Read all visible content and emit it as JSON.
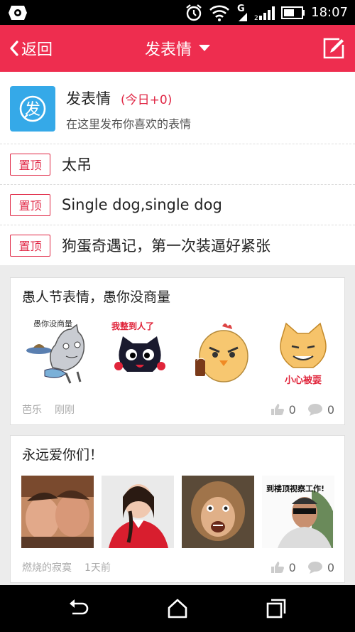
{
  "status_bar": {
    "time": "18:07",
    "icons": [
      "settings-icon",
      "alarm-icon",
      "wifi-icon",
      "signal-g-icon",
      "signal-bars-icon",
      "battery-icon"
    ]
  },
  "header": {
    "back_label": "返回",
    "title": "发表情",
    "icons": [
      "back-chevron-icon",
      "dropdown-arrow-icon",
      "edit-icon"
    ],
    "color": "#ee2d4f"
  },
  "category": {
    "icon_char": "发",
    "title": "发表情",
    "today_count": "(今日+0)",
    "description": "在这里发布你喜欢的表情",
    "icon_color": "#35a9e8"
  },
  "pinned": [
    {
      "badge": "置顶",
      "text": "太吊"
    },
    {
      "badge": "置顶",
      "text": "Single dog,single dog"
    },
    {
      "badge": "置顶",
      "text": "狗蛋奇遇记，第一次装逼好紧张"
    }
  ],
  "posts": [
    {
      "title": "愚人节表情，愚你没商量",
      "author": "芭乐",
      "time": "刚刚",
      "likes": "0",
      "comments": "0",
      "images": [
        {
          "kind": "sticker",
          "caption": "愚你没商量",
          "name": "gray-cat-waiter-sticker"
        },
        {
          "kind": "sticker",
          "caption": "我整到人了",
          "name": "black-cat-sticker"
        },
        {
          "kind": "sticker",
          "caption": "",
          "name": "angry-chick-sticker"
        },
        {
          "kind": "sticker",
          "caption": "小心被耍",
          "name": "orange-cat-sticker"
        }
      ]
    },
    {
      "title": "永远爱你们！",
      "author": "燃烧的寂寞",
      "time": "1天前",
      "likes": "0",
      "comments": "0",
      "images": [
        {
          "kind": "photo",
          "caption": "",
          "name": "two-men-photo"
        },
        {
          "kind": "photo",
          "caption": "",
          "name": "woman-red-jacket-photo"
        },
        {
          "kind": "photo",
          "caption": "",
          "name": "monkey-king-photo"
        },
        {
          "kind": "photo",
          "caption": "到楼顶视察工作!",
          "name": "man-sunglasses-photo"
        }
      ]
    }
  ],
  "nav": {
    "icons": [
      "back-icon",
      "home-icon",
      "recents-icon"
    ]
  }
}
